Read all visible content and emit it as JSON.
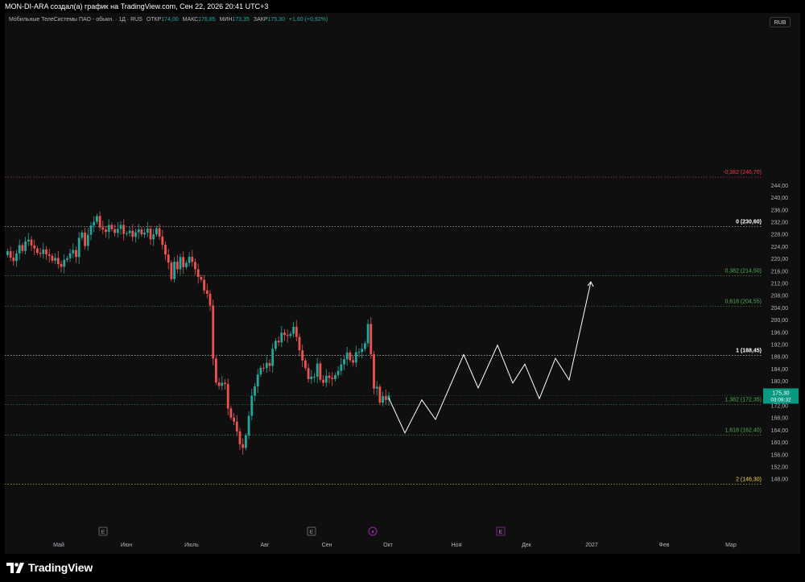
{
  "header": {
    "title": "MON-DI-ARA создал(а) график на TradingView.com, Сен 22, 2026 20:41 UTC+3"
  },
  "legend": {
    "symbol": "Мобильные ТелеСистемы ПАО - обыкн. · 1Д · RUS",
    "open_label": "ОТКР",
    "open": "174,00",
    "high_label": "МАКС",
    "high": "176,85",
    "low_label": "МИН",
    "low": "173,35",
    "close_label": "ЗАКР",
    "close": "175,30",
    "change": "+1,60 (+0,92%)"
  },
  "currency_button": "RUB",
  "footer": {
    "brand": "TradingView"
  },
  "colors": {
    "up": "#26a69a",
    "down": "#ef5350",
    "fib_white": "#ffffff",
    "fib_green": "#4caf50",
    "fib_red": "#f23645",
    "fib_yellow": "#f5d742",
    "price_label_bg": "#089981",
    "event_marker": "#9c27b0"
  },
  "chart_data": {
    "type": "candlestick",
    "y_axis_ticks": [
      "148,00",
      "152,00",
      "156,00",
      "160,00",
      "164,00",
      "168,00",
      "172,00",
      "176,00",
      "180,00",
      "184,00",
      "188,00",
      "192,00",
      "196,00",
      "200,00",
      "204,00",
      "208,00",
      "212,00",
      "216,00",
      "220,00",
      "224,00",
      "228,00",
      "232,00",
      "236,00",
      "240,00",
      "244,00"
    ],
    "x_axis_labels": [
      "Май",
      "Июн",
      "Июль",
      "Авг",
      "Сен",
      "Окт",
      "Ноя",
      "Дек",
      "2027",
      "Фев",
      "Мар"
    ],
    "last_price": "175,30",
    "countdown": "03:08:32",
    "fib_levels": [
      {
        "label": "-0,382 (246,70)",
        "value": 246.7,
        "color": "#f23645"
      },
      {
        "label": "0 (230,60)",
        "value": 230.6,
        "color": "#ffffff"
      },
      {
        "label": "0,382 (214,50)",
        "value": 214.5,
        "color": "#4caf50"
      },
      {
        "label": "0,618 (204,55)",
        "value": 204.55,
        "color": "#4caf50"
      },
      {
        "label": "1 (188,45)",
        "value": 188.45,
        "color": "#ffffff"
      },
      {
        "label": "1,382 (172,35)",
        "value": 172.35,
        "color": "#4caf50"
      },
      {
        "label": "1,618 (162,40)",
        "value": 162.4,
        "color": "#4caf50"
      },
      {
        "label": "2 (146,30)",
        "value": 146.3,
        "color": "#f5d742"
      }
    ],
    "events": [
      {
        "month": "Июн",
        "symbol": "E"
      },
      {
        "month": "Авг",
        "symbol": "E"
      },
      {
        "month": "Сен",
        "symbol": "⚡"
      },
      {
        "month": "Ноя",
        "symbol": "E"
      }
    ],
    "closes": [
      222.5,
      220.4,
      219.3,
      221.8,
      224.5,
      222.6,
      225.7,
      226.3,
      224.4,
      223.4,
      222,
      221.6,
      223.1,
      221.5,
      221,
      219.4,
      220.3,
      218.3,
      217.4,
      219.7,
      220.2,
      221.8,
      222.9,
      220.6,
      226.9,
      228.6,
      224.2,
      227.9,
      230.9,
      232.1,
      234,
      230.3,
      229.6,
      228.8,
      231.1,
      229.7,
      228.5,
      229.8,
      231.1,
      228.2,
      228.4,
      229.2,
      227.2,
      228.7,
      229.6,
      228,
      228.6,
      229.9,
      226.4,
      228,
      230,
      227.3,
      224.6,
      221.4,
      218.8,
      213.4,
      219.1,
      216.6,
      220.6,
      217.3,
      218.7,
      220.7,
      219,
      216.6,
      214.1,
      213.2,
      209.7,
      208.6,
      204.8,
      187.4,
      179.6,
      178.5,
      179.5,
      179.1,
      171.1,
      168.1,
      166.8,
      163.6,
      159.4,
      158.2,
      162.3,
      168.7,
      175.3,
      178.3,
      182.2,
      184.4,
      184.3,
      186,
      185,
      190.6,
      193.2,
      192.7,
      195.9,
      195.1,
      194.8,
      195.5,
      197.8,
      194.5,
      190.1,
      186.8,
      184.3,
      180.7,
      181.5,
      181.5,
      185.8,
      180.5,
      179.5,
      181.8,
      181.1,
      180.7,
      182,
      183.4,
      185.5,
      187.2,
      189.4,
      186.9,
      186.1,
      189.5,
      189.6,
      190.6,
      192.4,
      198.7,
      188.8,
      177.6,
      178.2,
      173,
      175.1,
      173.9,
      175.3
    ],
    "projection_wave": [
      174.5,
      163.1,
      173.9,
      167.5,
      188.7,
      177.8,
      191.8,
      179.4,
      185.6,
      174.3,
      187.5,
      180.4,
      212.5
    ]
  }
}
